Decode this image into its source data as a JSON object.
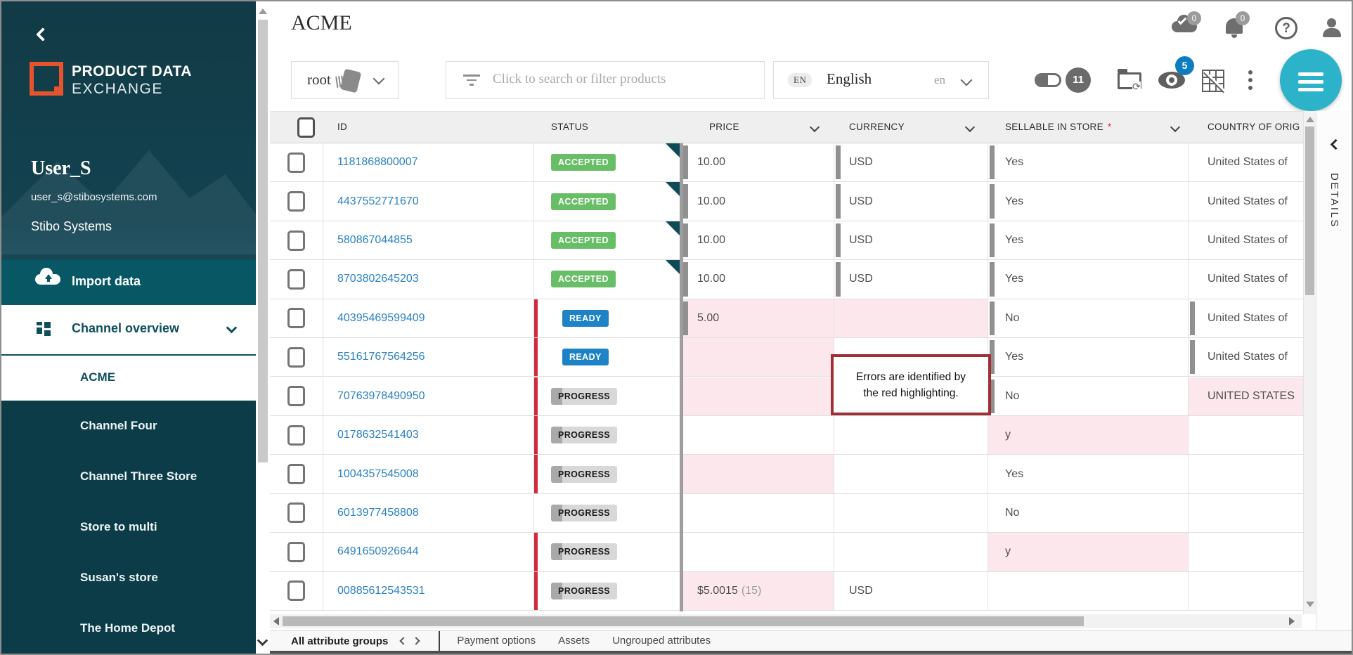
{
  "sidebar": {
    "logo_line1": "PRODUCT DATA",
    "logo_line2": "EXCHANGE",
    "user_name": "User_S",
    "user_email": "user_s@stibosystems.com",
    "org": "Stibo Systems",
    "import_item": "Import data",
    "overview_item": "Channel overview",
    "selected_channel": "ACME",
    "channel_items": [
      "Channel Four",
      "Channel Three Store",
      "Store to multi",
      "Susan's store",
      "The Home Depot"
    ]
  },
  "topbar": {
    "title": "ACME",
    "root_label": "root",
    "search_placeholder": "Click to search or filter products",
    "language": {
      "code_badge": "EN",
      "name": "English",
      "short": "en"
    },
    "badges": {
      "approvals": "0",
      "notifications": "0",
      "columns_count": "11",
      "views_count": "5"
    },
    "icons": [
      "toggle-columns-icon",
      "folder-sync-icon",
      "eye-icon",
      "no-grid-icon",
      "kebab-menu-icon",
      "menu-fab",
      "cloud-check-icon",
      "bell-icon",
      "help-icon",
      "user-icon"
    ]
  },
  "table": {
    "columns": [
      "ID",
      "STATUS",
      "PRICE",
      "CURRENCY",
      "SELLABLE IN STORE",
      "COUNTRY OF ORIG"
    ],
    "required_mark": "*",
    "rows": [
      {
        "id": "1181868800007",
        "status": "ACCEPTED",
        "type": "accepted",
        "red": false,
        "corner": true,
        "price": {
          "t": "10.00",
          "mark": true
        },
        "cur": {
          "t": "USD",
          "mark": true
        },
        "sell": {
          "t": "Yes",
          "mark": true
        },
        "country": {
          "t": "United States of"
        }
      },
      {
        "id": "4437552771670",
        "status": "ACCEPTED",
        "type": "accepted",
        "red": false,
        "corner": true,
        "price": {
          "t": "10.00",
          "mark": true
        },
        "cur": {
          "t": "USD",
          "mark": true
        },
        "sell": {
          "t": "Yes",
          "mark": true
        },
        "country": {
          "t": "United States of"
        }
      },
      {
        "id": "580867044855",
        "status": "ACCEPTED",
        "type": "accepted",
        "red": false,
        "corner": true,
        "price": {
          "t": "10.00",
          "mark": true
        },
        "cur": {
          "t": "USD",
          "mark": true
        },
        "sell": {
          "t": "Yes",
          "mark": true
        },
        "country": {
          "t": "United States of"
        }
      },
      {
        "id": "8703802645203",
        "status": "ACCEPTED",
        "type": "accepted",
        "red": false,
        "corner": true,
        "price": {
          "t": "10.00",
          "mark": true
        },
        "cur": {
          "t": "USD",
          "mark": true
        },
        "sell": {
          "t": "Yes",
          "mark": true
        },
        "country": {
          "t": "United States of"
        }
      },
      {
        "id": "40395469599409",
        "status": "READY",
        "type": "ready",
        "red": true,
        "corner": false,
        "price": {
          "t": "5.00",
          "pink": true,
          "mark": true
        },
        "cur": {
          "t": "",
          "pink": true
        },
        "sell": {
          "t": "No",
          "mark": true
        },
        "country": {
          "t": "United States of",
          "mark": true
        }
      },
      {
        "id": "55161767564256",
        "status": "READY",
        "type": "ready",
        "red": true,
        "corner": false,
        "price": {
          "t": "",
          "pink": true
        },
        "cur": {
          "t": ""
        },
        "sell": {
          "t": "Yes",
          "mark": true
        },
        "country": {
          "t": "United States of",
          "mark": true
        }
      },
      {
        "id": "70763978490950",
        "status": "PROGRESS",
        "type": "progress",
        "red": true,
        "corner": false,
        "price": {
          "t": "",
          "pink": true
        },
        "cur": {
          "t": ""
        },
        "sell": {
          "t": "No",
          "mark": true
        },
        "country": {
          "t": "UNITED STATES",
          "pink": true
        }
      },
      {
        "id": "0178632541403",
        "status": "PROGRESS",
        "type": "progress",
        "red": true,
        "corner": false,
        "price": {
          "t": ""
        },
        "cur": {
          "t": ""
        },
        "sell": {
          "t": "y",
          "pink": true
        },
        "country": {
          "t": ""
        }
      },
      {
        "id": "1004357545008",
        "status": "PROGRESS",
        "type": "progress",
        "red": true,
        "corner": false,
        "price": {
          "t": "",
          "pink": true
        },
        "cur": {
          "t": ""
        },
        "sell": {
          "t": "Yes"
        },
        "country": {
          "t": ""
        }
      },
      {
        "id": "6013977458808",
        "status": "PROGRESS",
        "type": "progress",
        "red": false,
        "corner": false,
        "price": {
          "t": ""
        },
        "cur": {
          "t": ""
        },
        "sell": {
          "t": "No"
        },
        "country": {
          "t": ""
        }
      },
      {
        "id": "6491650926644",
        "status": "PROGRESS",
        "type": "progress",
        "red": true,
        "corner": false,
        "price": {
          "t": ""
        },
        "cur": {
          "t": ""
        },
        "sell": {
          "t": "y",
          "pink": true
        },
        "country": {
          "t": ""
        }
      },
      {
        "id": "00885612543531",
        "status": "PROGRESS",
        "type": "progress",
        "red": true,
        "corner": false,
        "price": {
          "t": "$5.0015",
          "suffix": "(15)",
          "pink": true
        },
        "cur": {
          "t": "USD"
        },
        "sell": {
          "t": ""
        },
        "country": {
          "t": ""
        }
      }
    ]
  },
  "annotation": {
    "line1": "Errors are identified by",
    "line2": "the red highlighting."
  },
  "bottom_tabs": {
    "active": "All attribute groups",
    "items": [
      "Payment options",
      "Assets",
      "Ungrouped attributes"
    ]
  },
  "details_panel": {
    "label": "DETAILS"
  },
  "colors": {
    "accent_teal": "#0f4e5d",
    "fab_teal": "#2cb3ca",
    "error_red": "#d2293d",
    "error_pink": "#fce8ec",
    "accepted_green": "#68bd67",
    "ready_blue": "#1e83c6",
    "link_blue": "#2b82c4",
    "orange_brand": "#e7532c"
  }
}
